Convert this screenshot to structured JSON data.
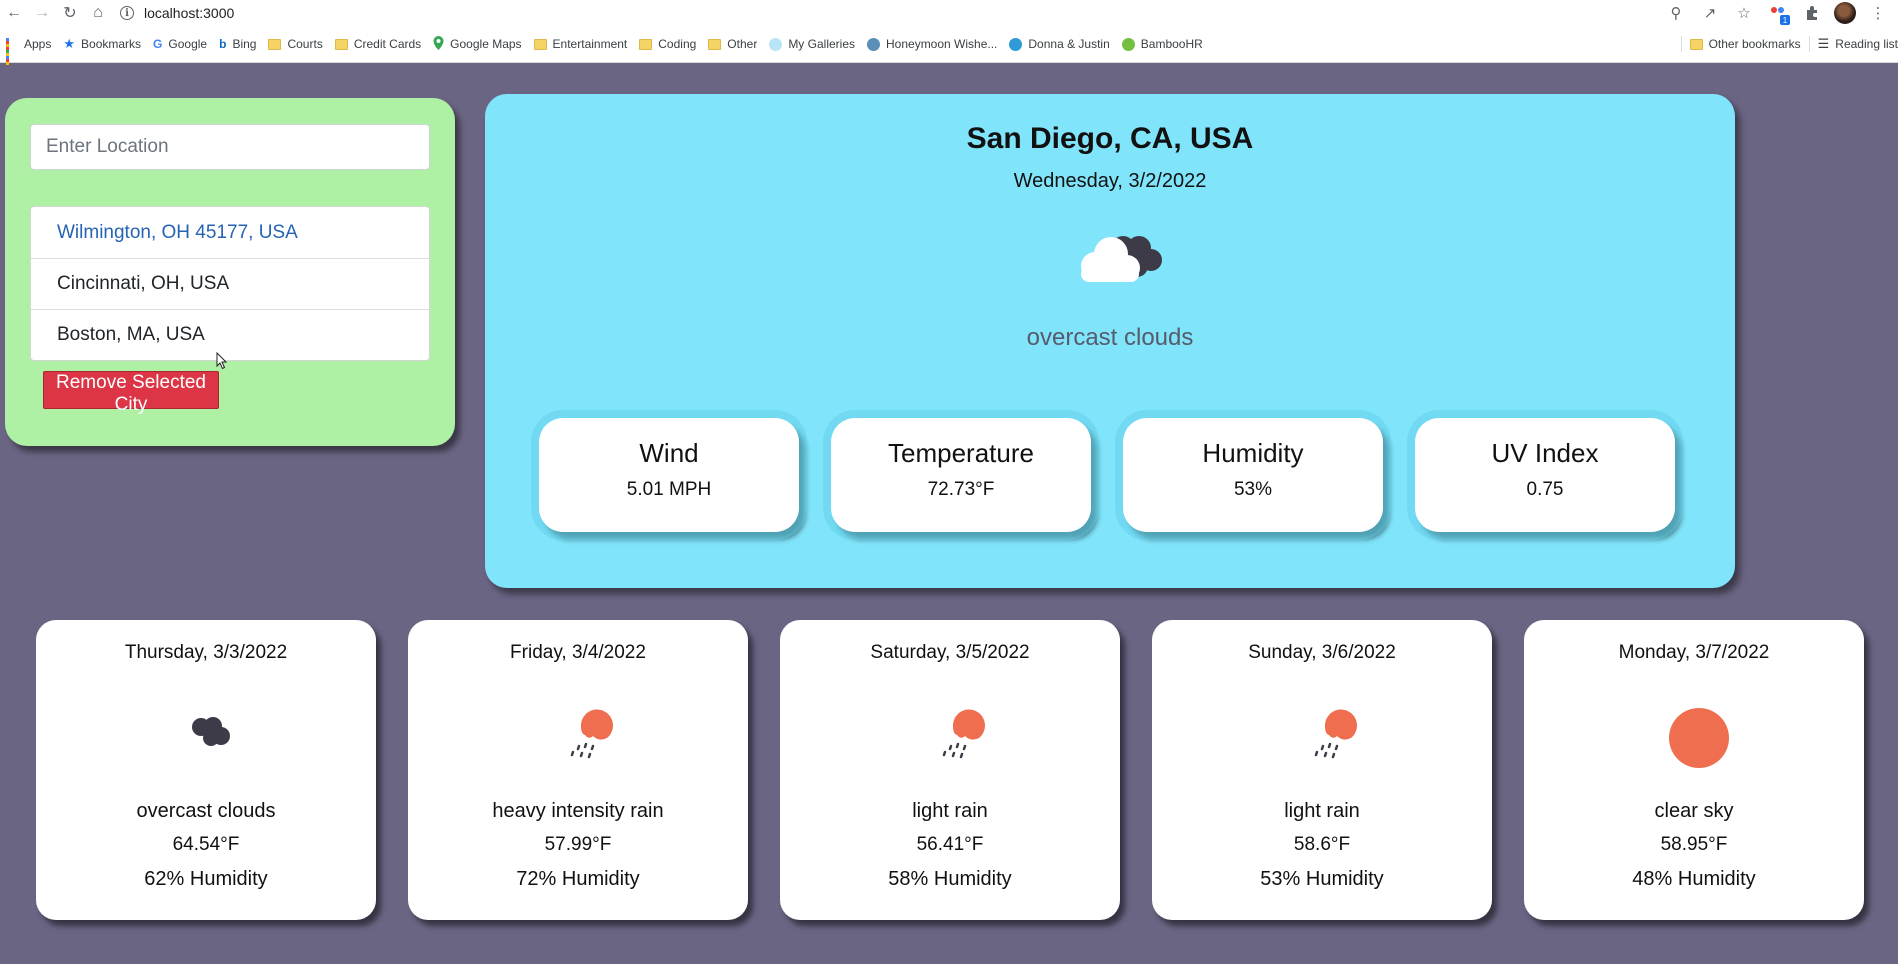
{
  "browser": {
    "url": "localhost:3000",
    "bookmarks": [
      {
        "label": "Apps",
        "icon": "apps-grid-icon"
      },
      {
        "label": "Bookmarks",
        "icon": "star-icon"
      },
      {
        "label": "Google",
        "icon": "google-icon"
      },
      {
        "label": "Bing",
        "icon": "bing-icon"
      },
      {
        "label": "Courts",
        "icon": "folder-icon"
      },
      {
        "label": "Credit Cards",
        "icon": "folder-icon"
      },
      {
        "label": "Google Maps",
        "icon": "map-pin-icon"
      },
      {
        "label": "Entertainment",
        "icon": "folder-icon"
      },
      {
        "label": "Coding",
        "icon": "folder-icon"
      },
      {
        "label": "Other",
        "icon": "folder-icon"
      },
      {
        "label": "My Galleries",
        "icon": "gallery-icon"
      },
      {
        "label": "Honeymoon Wishe...",
        "icon": "globe-icon"
      },
      {
        "label": "Donna & Justin",
        "icon": "globe-icon"
      },
      {
        "label": "BambooHR",
        "icon": "bamboo-icon"
      }
    ],
    "other_bookmarks": "Other bookmarks",
    "reading_list": "Reading list",
    "extension_badge": "1"
  },
  "sidebar": {
    "location_placeholder": "Enter Location",
    "cities": [
      "Wilmington, OH 45177, USA",
      "Cincinnati, OH, USA",
      "Boston, MA, USA"
    ],
    "remove_button": "Remove Selected City"
  },
  "current": {
    "city": "San Diego, CA, USA",
    "date": "Wednesday, 3/2/2022",
    "icon": "overcast-clouds-icon",
    "description": "overcast clouds",
    "stats": [
      {
        "label": "Wind",
        "value": "5.01 MPH"
      },
      {
        "label": "Temperature",
        "value": "72.73°F"
      },
      {
        "label": "Humidity",
        "value": "53%"
      },
      {
        "label": "UV Index",
        "value": "0.75"
      }
    ]
  },
  "forecast": [
    {
      "date": "Thursday, 3/3/2022",
      "icon": "overcast-clouds-icon",
      "description": "overcast clouds",
      "temp": "64.54°F",
      "humidity": "62% Humidity"
    },
    {
      "date": "Friday, 3/4/2022",
      "icon": "rain-icon",
      "description": "heavy intensity rain",
      "temp": "57.99°F",
      "humidity": "72% Humidity"
    },
    {
      "date": "Saturday, 3/5/2022",
      "icon": "rain-icon",
      "description": "light rain",
      "temp": "56.41°F",
      "humidity": "58% Humidity"
    },
    {
      "date": "Sunday, 3/6/2022",
      "icon": "rain-icon",
      "description": "light rain",
      "temp": "58.6°F",
      "humidity": "53% Humidity"
    },
    {
      "date": "Monday, 3/7/2022",
      "icon": "sun-icon",
      "description": "clear sky",
      "temp": "58.95°F",
      "humidity": "48% Humidity"
    }
  ],
  "colors": {
    "page_background": "#6b6584",
    "sidebar_background": "#aef0a4",
    "main_panel_background": "#80e5fb",
    "remove_button": "#dc3545",
    "selected_city_text": "#2563b5",
    "sun": "#ee6e4f",
    "cloud_dark": "#3d3b48"
  }
}
